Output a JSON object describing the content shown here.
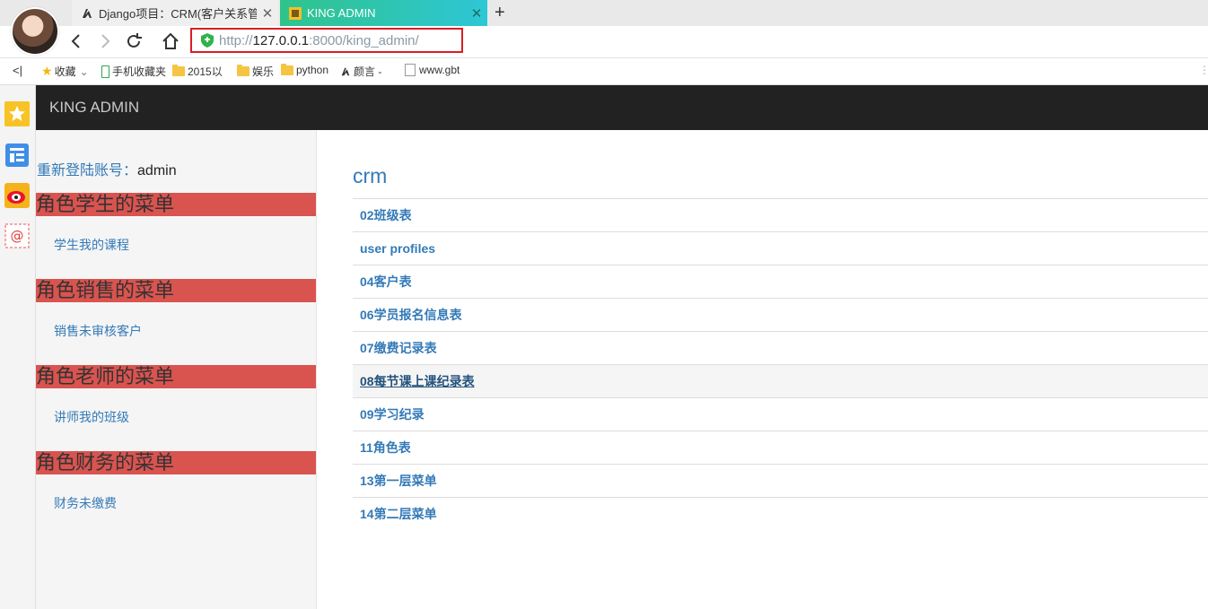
{
  "browser": {
    "tabs": [
      {
        "title": "Django项目：CRM(客户关系管",
        "active": false
      },
      {
        "title": "KING ADMIN",
        "active": true
      }
    ],
    "new_tab_label": "+",
    "address": {
      "scheme": "http://",
      "host": "127.0.0.1",
      "port_path": ":8000/king_admin/"
    },
    "bookmarks": [
      {
        "label": "收藏",
        "icon": "star-icon"
      },
      {
        "label": "手机收藏夹",
        "icon": "phone-icon"
      },
      {
        "label": "2015以",
        "icon": "folder-icon"
      },
      {
        "label": "娱乐",
        "icon": "folder-icon"
      },
      {
        "label": "python",
        "icon": "folder-icon"
      },
      {
        "label": "颜言 -",
        "icon": "django-icon"
      },
      {
        "label": "www.gbt",
        "icon": "page-icon"
      }
    ],
    "side_rail_icons": [
      "favorites-star-icon",
      "reader-icon",
      "weibo-icon",
      "mail-icon"
    ],
    "accent_color": "#2fc38a"
  },
  "page": {
    "brand": "KING ADMIN",
    "header_bg": "#222222",
    "sidebar": {
      "login_label": "重新登陆账号：",
      "login_user": "admin",
      "menus": [
        {
          "title": "角色学生的菜单",
          "link": "学生我的课程"
        },
        {
          "title": "角色销售的菜单",
          "link": "销售未审核客户"
        },
        {
          "title": "角色老师的菜单",
          "link": "讲师我的班级"
        },
        {
          "title": "角色财务的菜单",
          "link": "财务未缴费"
        }
      ],
      "menu_head_color": "#d9534f"
    },
    "main": {
      "app_title": "crm",
      "models": [
        "02班级表",
        "user profiles",
        "04客户表",
        "06学员报名信息表",
        "07缴费记录表",
        "08每节课上课纪录表",
        "09学习纪录",
        "11角色表",
        "13第一层菜单",
        "14第二层菜单"
      ],
      "hovered_model": "08每节课上课纪录表"
    }
  }
}
